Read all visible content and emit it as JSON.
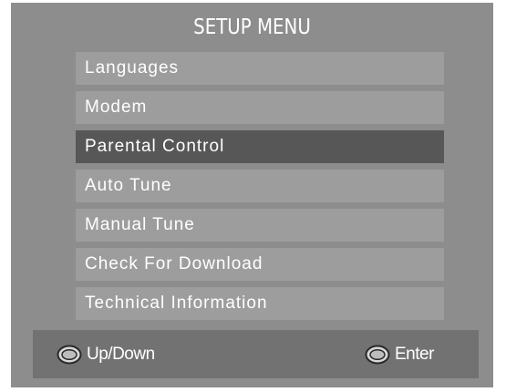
{
  "menu": {
    "title": "SETUP MENU",
    "items": [
      {
        "label": "Languages"
      },
      {
        "label": "Modem"
      },
      {
        "label": "Parental Control",
        "selected": true
      },
      {
        "label": "Auto Tune"
      },
      {
        "label": "Manual Tune"
      },
      {
        "label": "Check For Download"
      },
      {
        "label": "Technical Information"
      }
    ]
  },
  "footer": {
    "nav_hint": {
      "icon": "remote-oval-button-icon",
      "label": "Up/Down"
    },
    "enter_hint": {
      "icon": "remote-oval-button-icon",
      "label": "Enter"
    }
  },
  "colors": {
    "background": "#8d8d8d",
    "item": "#9d9d9d",
    "item_selected": "#575757",
    "footer": "#727272",
    "text": "#ffffff"
  }
}
